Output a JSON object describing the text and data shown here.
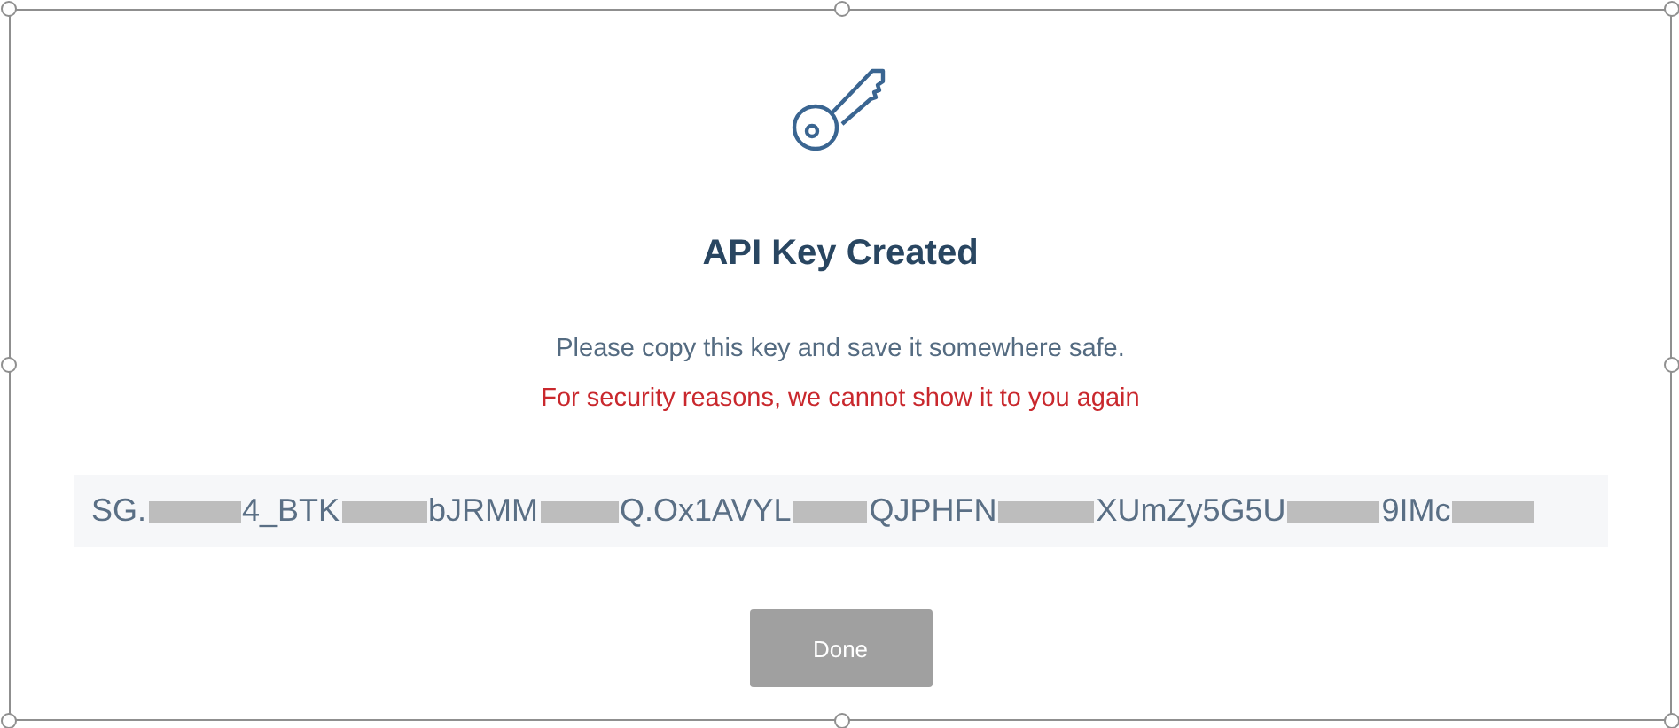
{
  "dialog": {
    "title": "API Key Created",
    "message": "Please copy this key and save it somewhere safe.",
    "warning": "For security reasons, we cannot show it to you again",
    "key_segments": [
      {
        "kind": "text",
        "text": "SG."
      },
      {
        "kind": "redaction"
      },
      {
        "kind": "text",
        "text": "4_BTK"
      },
      {
        "kind": "redaction"
      },
      {
        "kind": "text",
        "text": "bJRMM"
      },
      {
        "kind": "redaction"
      },
      {
        "kind": "text",
        "text": "Q.Ox1AVYL"
      },
      {
        "kind": "redaction"
      },
      {
        "kind": "text",
        "text": "QJPHFN"
      },
      {
        "kind": "redaction"
      },
      {
        "kind": "text",
        "text": "XUmZy5G5U"
      },
      {
        "kind": "redaction"
      },
      {
        "kind": "text",
        "text": "9IMc"
      },
      {
        "kind": "redaction"
      }
    ],
    "button": {
      "label": "Done",
      "disabled": true
    }
  },
  "selection_frame": {
    "selected": true
  }
}
